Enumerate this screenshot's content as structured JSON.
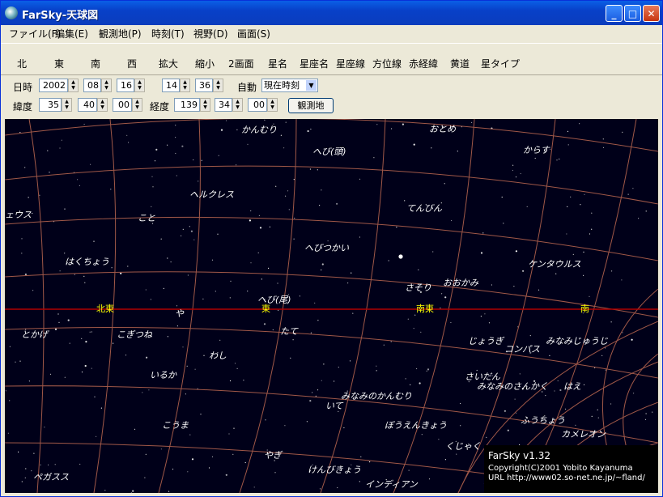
{
  "window": {
    "title": "FarSky-天球図",
    "min_label": "_",
    "max_label": "□",
    "close_label": "✕"
  },
  "menu": [
    "ファイル(F)",
    "編集(E)",
    "観測地(P)",
    "時刻(T)",
    "視野(D)",
    "画面(S)"
  ],
  "toolbar": [
    "北",
    "東",
    "南",
    "西",
    "拡大",
    "縮小",
    "2画面",
    "星名",
    "星座名",
    "星座線",
    "方位線",
    "赤経緯",
    "黄道",
    "星タイプ"
  ],
  "datetime": {
    "label": "日時",
    "year": "2002",
    "month": "08",
    "day": "16",
    "hour": "14",
    "minute": "36",
    "auto_label": "自動",
    "auto_value": "現在時刻"
  },
  "location": {
    "lat_label": "緯度",
    "lat_deg": "35",
    "lat_min": "40",
    "lat_sec": "00",
    "lon_label": "経度",
    "lon_deg": "139",
    "lon_min": "34",
    "lon_sec": "00",
    "button": "観測地"
  },
  "sky": {
    "constellations": [
      "かんむり",
      "おとめ",
      "へび(頭)",
      "からす",
      "ヘルクレス",
      "てんびん",
      "ェウス",
      "こと",
      "へびつかい",
      "はくちょう",
      "ケンタウルス",
      "さそり",
      "おおかみ",
      "へび(尾)",
      "や",
      "とかげ",
      "こぎつね",
      "たて",
      "じょうぎ",
      "コンパス",
      "みなみじゅうじ",
      "わし",
      "いるか",
      "さいだん",
      "みなみのさんかく",
      "はえ",
      "みなみのかんむり",
      "いて",
      "こうま",
      "ぼうえんきょう",
      "ふうちょう",
      "カメレオン",
      "くじゃく",
      "やぎ",
      "けんびきょう",
      "ペガスス",
      "インディアン"
    ],
    "directions": [
      "北東",
      "東",
      "南東",
      "南"
    ],
    "info": [
      "FarSky v1.32",
      "Copyright(C)2001 Yobito Kayanuma",
      "URL http://www02.so-net.ne.jp/~fland/"
    ],
    "colors": {
      "background": "#000019",
      "grid": "#a05848",
      "horizon": "#b00000",
      "direction_text": "#ffff00",
      "label": "#ffffff"
    }
  }
}
